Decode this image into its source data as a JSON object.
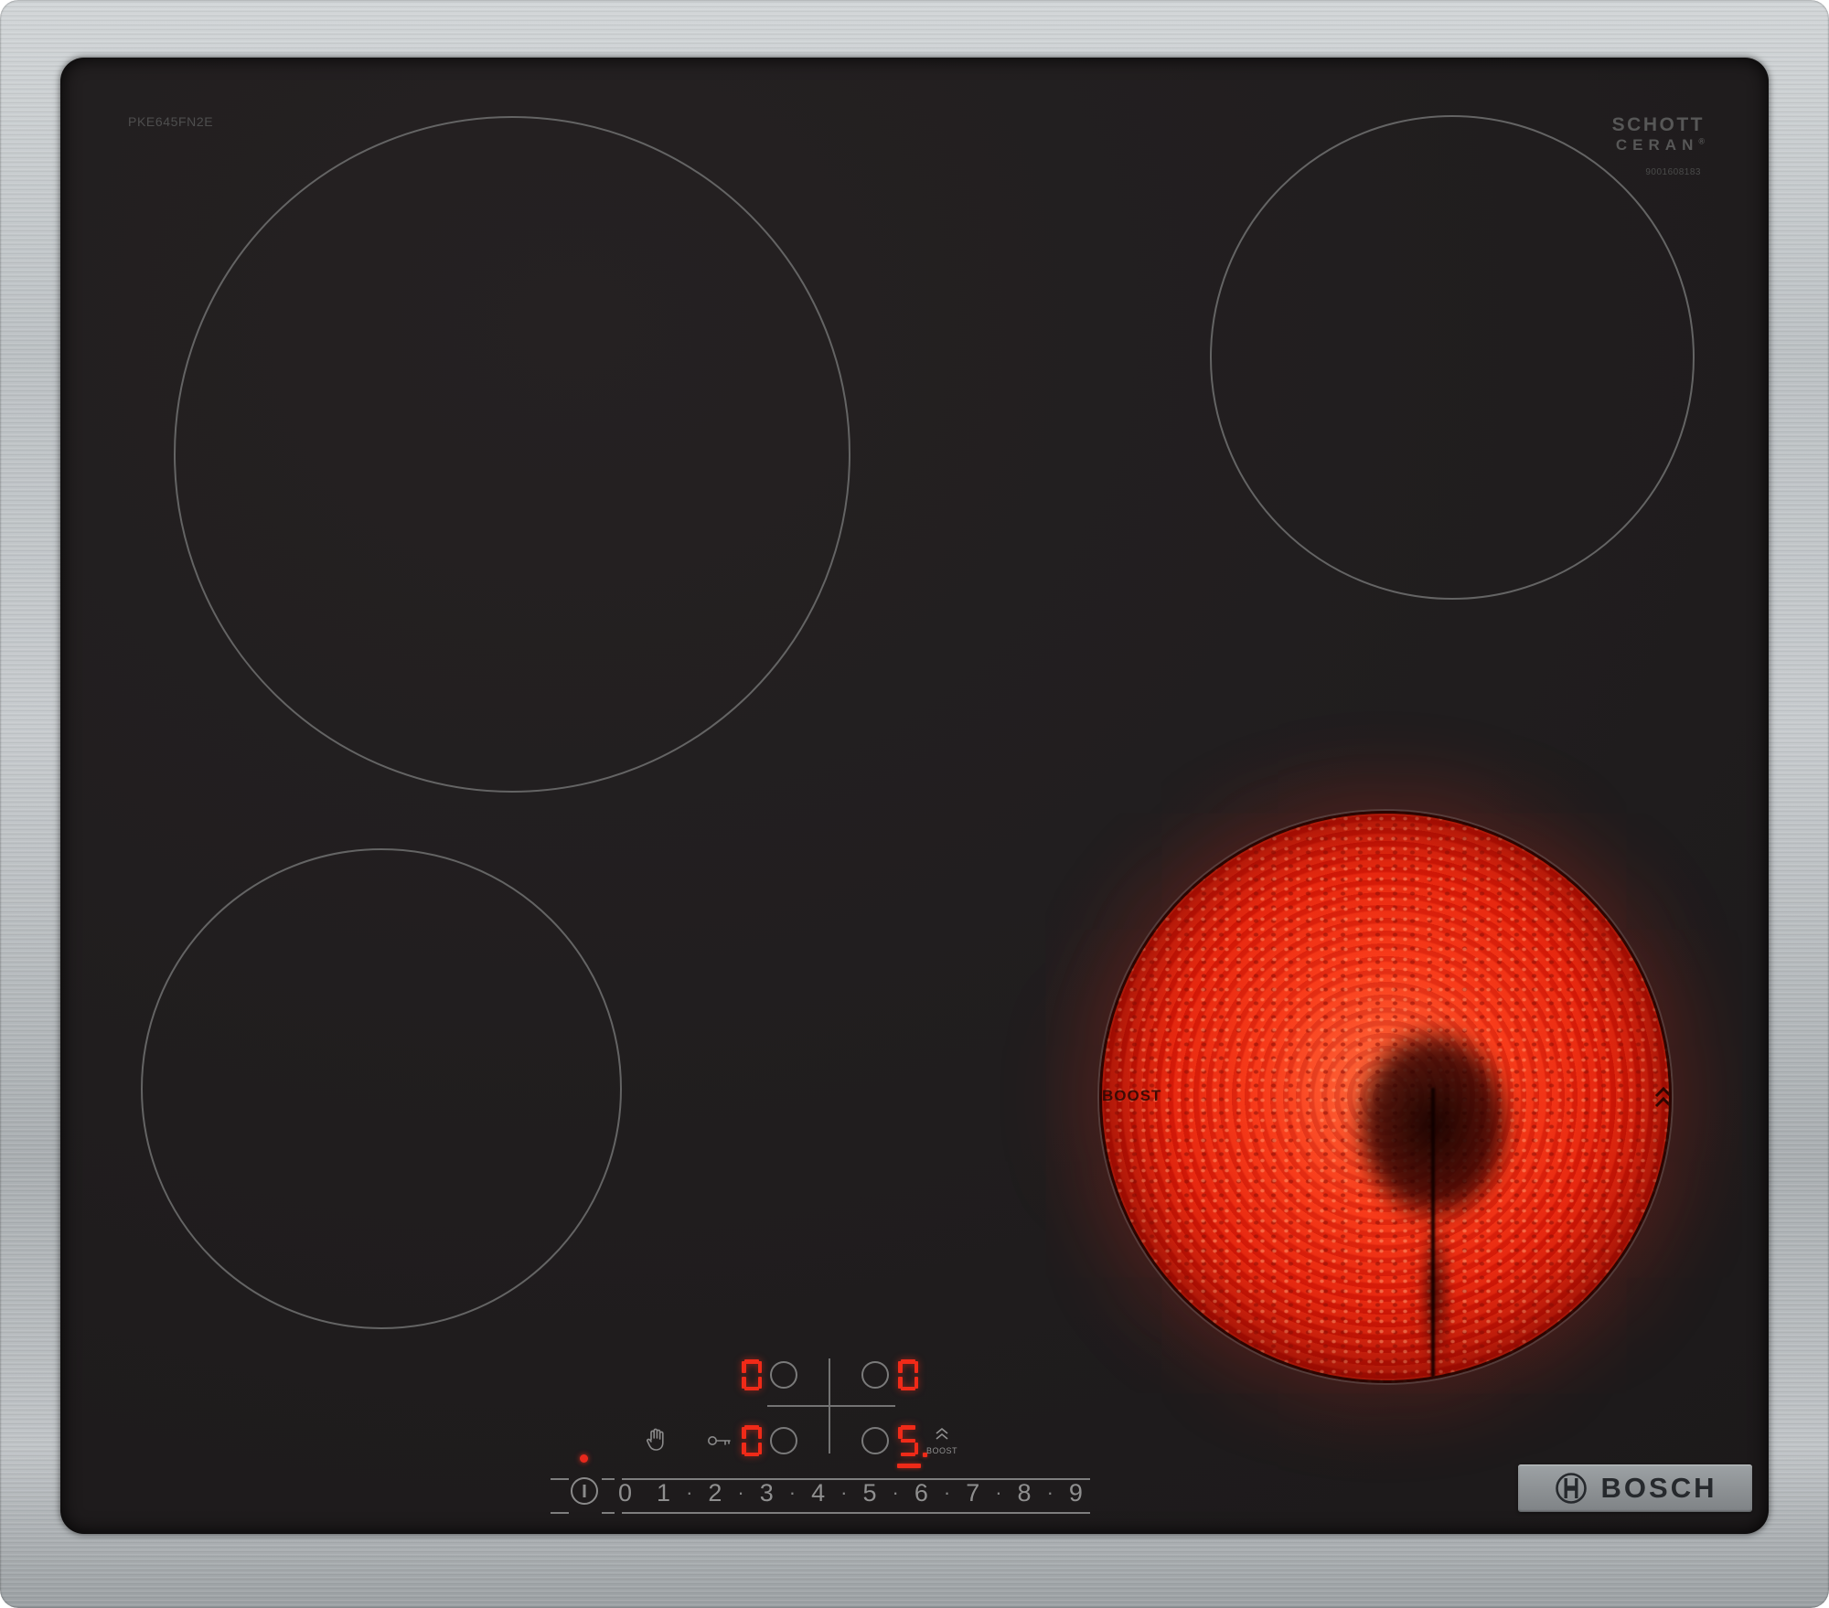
{
  "product": {
    "model": "PKE645FN2E",
    "brand": "BOSCH",
    "glass_brand_line1": "SCHOTT",
    "glass_brand_line2": "CERAN",
    "glass_brand_reg": "®",
    "glass_code": "9001608183"
  },
  "panel": {
    "zones": [
      {
        "id": "rear-left",
        "value": "0"
      },
      {
        "id": "rear-right",
        "value": "0"
      },
      {
        "id": "front-left",
        "value": "0"
      },
      {
        "id": "front-right",
        "value": "5",
        "state": "active-selected-with-decimal-point"
      }
    ],
    "boost_label": "BOOST",
    "icons": {
      "power": "power-icon",
      "pause": "hand-icon",
      "child_lock": "key-icon",
      "boost": "double-chevron-up-icon",
      "main_on_indicator": "red-dot-indicator",
      "brand_symbol": "bosch-armature-icon"
    }
  },
  "slider": {
    "levels": [
      "0",
      "1",
      "2",
      "3",
      "4",
      "5",
      "6",
      "7",
      "8",
      "9"
    ],
    "separator": "·"
  },
  "active_zone": {
    "print_label": "BOOST",
    "level": "5"
  },
  "colors": {
    "frame_steel": "#bcc1c4",
    "glass_black": "#201d1e",
    "zone_outline_gray": "#646464",
    "display_red": "#f02a18",
    "heat_glow_red": "#e31c08",
    "control_gray": "#8a8a8a",
    "badge_bg": "#8c9093",
    "badge_text": "#26292d"
  }
}
